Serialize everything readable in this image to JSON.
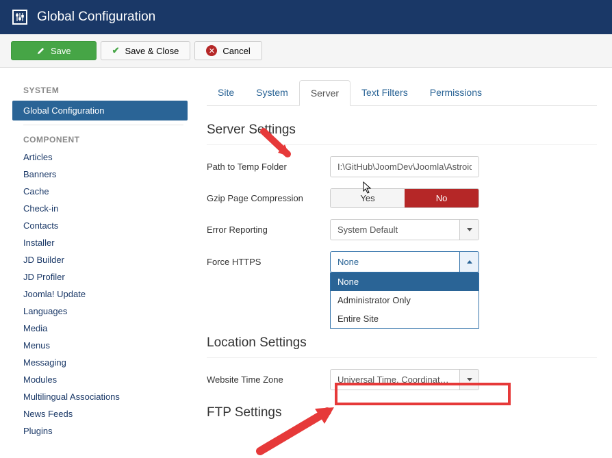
{
  "header": {
    "title": "Global Configuration"
  },
  "toolbar": {
    "save": "Save",
    "save_close": "Save & Close",
    "cancel": "Cancel"
  },
  "sidebar": {
    "system_heading": "SYSTEM",
    "system_items": [
      {
        "label": "Global Configuration",
        "active": true
      }
    ],
    "component_heading": "COMPONENT",
    "component_items": [
      "Articles",
      "Banners",
      "Cache",
      "Check-in",
      "Contacts",
      "Installer",
      "JD Builder",
      "JD Profiler",
      "Joomla! Update",
      "Languages",
      "Media",
      "Menus",
      "Messaging",
      "Modules",
      "Multilingual Associations",
      "News Feeds",
      "Plugins"
    ]
  },
  "tabs": [
    "Site",
    "System",
    "Server",
    "Text Filters",
    "Permissions"
  ],
  "active_tab": "Server",
  "sections": {
    "server_settings": "Server Settings",
    "location_settings": "Location Settings",
    "ftp_settings": "FTP Settings"
  },
  "fields": {
    "temp_folder_label": "Path to Temp Folder",
    "temp_folder_value": "I:\\GitHub\\JoomDev\\Joomla\\Astroid-I",
    "gzip_label": "Gzip Page Compression",
    "gzip_yes": "Yes",
    "gzip_no": "No",
    "error_label": "Error Reporting",
    "error_value": "System Default",
    "https_label": "Force HTTPS",
    "https_value": "None",
    "https_options": [
      "None",
      "Administrator Only",
      "Entire Site"
    ],
    "tz_label": "Website Time Zone",
    "tz_value": "Universal Time, Coordinated …"
  }
}
